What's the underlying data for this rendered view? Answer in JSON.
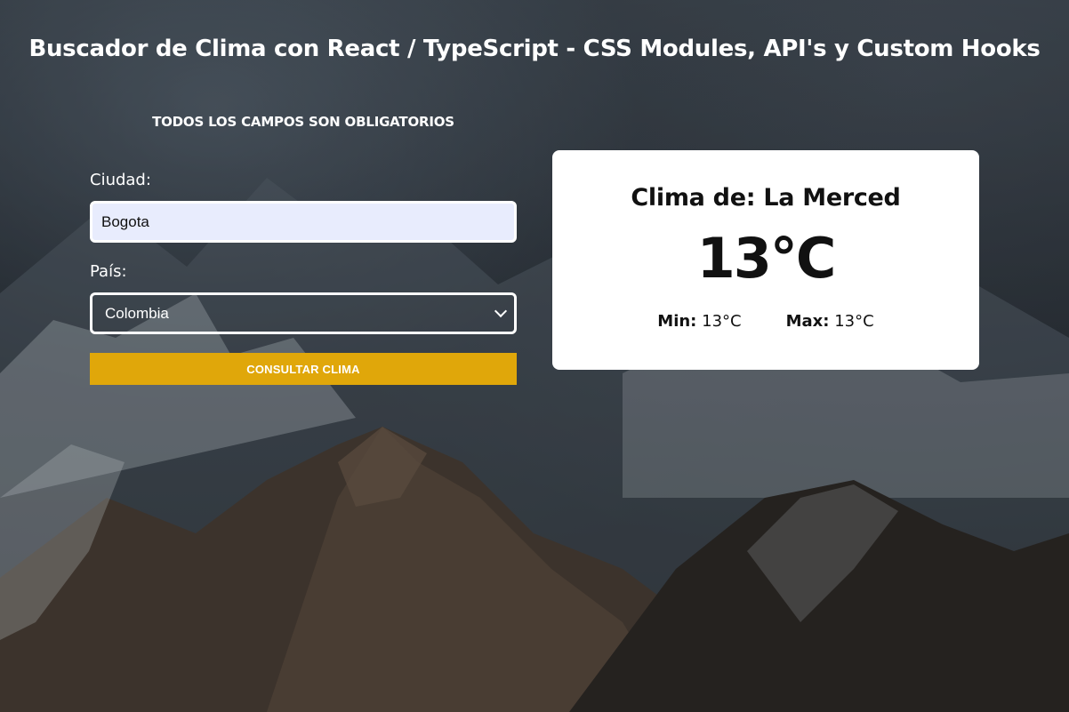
{
  "page": {
    "title": "Buscador de Clima con React / TypeScript - CSS Modules, API's y Custom Hooks"
  },
  "form": {
    "notice": "TODOS LOS CAMPOS SON OBLIGATORIOS",
    "city_label": "Ciudad:",
    "city_value": "Bogota",
    "country_label": "País:",
    "country_value": "Colombia",
    "submit_label": "CONSULTAR CLIMA"
  },
  "result": {
    "title": "Clima de: La Merced",
    "temperature": "13°C",
    "min_label": "Min:",
    "min_value": "13°C",
    "max_label": "Max:",
    "max_value": "13°C"
  },
  "colors": {
    "accent": "#e0a70a",
    "input_bg": "#e8ecfd",
    "card_bg": "#ffffff"
  }
}
